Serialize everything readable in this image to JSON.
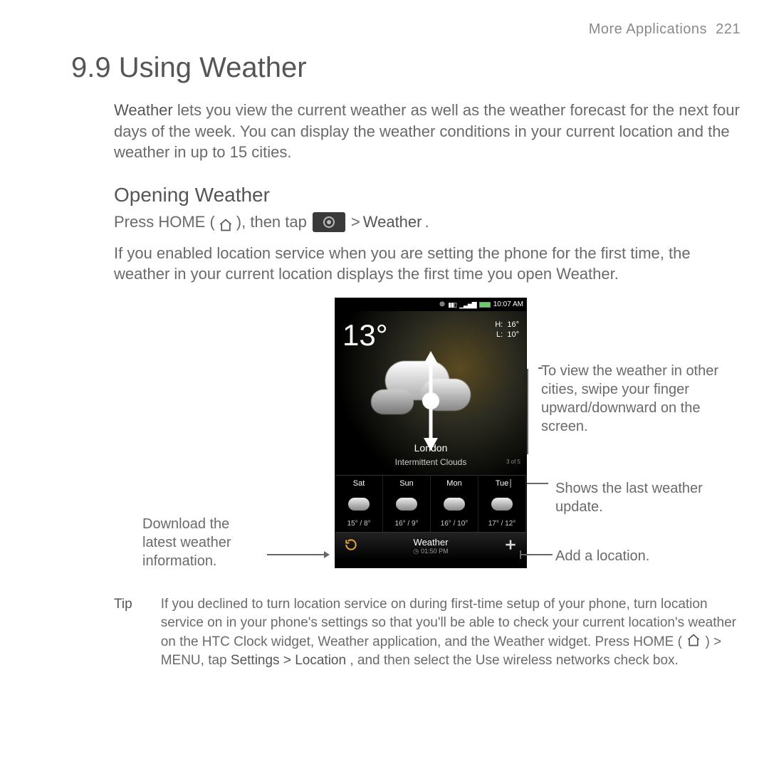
{
  "header": {
    "section": "More Applications",
    "page_number": "221"
  },
  "title": "9.9  Using Weather",
  "intro": {
    "lead_word": "Weather",
    "rest": " lets you view the current weather as well as the weather forecast for the next four days of the week. You can display the weather conditions in your current location and the weather in up to 15 cities."
  },
  "subhead": "Opening Weather",
  "open_line": {
    "p1": "Press HOME ( ",
    "p2": " ), then tap ",
    "p3": "  > ",
    "p4": "Weather",
    "p5": "."
  },
  "para2": "If you enabled location service when you are setting the phone for the first time, the weather in your current location displays the first time you open Weather.",
  "callouts": {
    "swipe": "To view the weather in other cities, swipe your finger upward/downward on the screen.",
    "last_update": "Shows the last weather update.",
    "add_location": "Add a location.",
    "download": "Download the latest weather information."
  },
  "phone": {
    "statusbar_time": "10:07 AM",
    "temp": "13°",
    "hi_label": "H:",
    "hi": "16°",
    "lo_label": "L:",
    "lo": "10°",
    "city": "London",
    "desc": "Intermittent Clouds",
    "counter": "3 of 5",
    "forecast": [
      {
        "day": "Sat",
        "t": "15° / 8°"
      },
      {
        "day": "Sun",
        "t": "16° / 9°"
      },
      {
        "day": "Mon",
        "t": "16° / 10°"
      },
      {
        "day": "Tue",
        "t": "17° / 12°"
      }
    ],
    "bottom_label": "Weather",
    "bottom_time": "01:50 PM"
  },
  "tip": {
    "label": "Tip",
    "t1": "If you declined to turn location service on during first-time setup of your phone, turn location service on in your phone's settings so that you'll be able to check your current location's weather on the HTC Clock widget, Weather application, and the Weather widget. Press HOME ( ",
    "t2": " ) > MENU, tap ",
    "t3": "Settings > Location",
    "t4": ", and then select the Use wireless networks check box."
  }
}
